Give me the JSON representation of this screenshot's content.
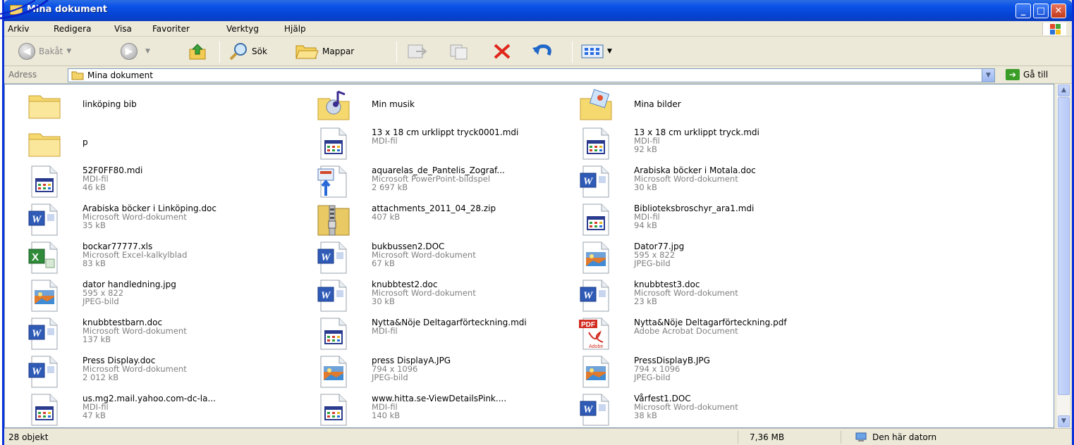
{
  "window": {
    "title": "Mina dokument"
  },
  "menu": [
    "Arkiv",
    "Redigera",
    "Visa",
    "Favoriter",
    "Verktyg",
    "Hjälp"
  ],
  "toolbar": {
    "back": "Bakåt",
    "search": "Sök",
    "folders": "Mappar"
  },
  "address": {
    "label": "Adress",
    "value": "Mina dokument",
    "go": "Gå till"
  },
  "items": [
    {
      "name": "linköping bib",
      "type": "",
      "size": "",
      "icon": "folder-icon"
    },
    {
      "name": "Min musik",
      "type": "",
      "size": "",
      "icon": "music-folder-icon"
    },
    {
      "name": "Mina bilder",
      "type": "",
      "size": "",
      "icon": "pictures-folder-icon"
    },
    {
      "name": "p",
      "type": "",
      "size": "",
      "icon": "folder-icon"
    },
    {
      "name": "13 x 18 cm urklippt tryck0001.mdi",
      "type": "MDI-fil",
      "size": "",
      "icon": "mdi-file-icon"
    },
    {
      "name": "13 x 18 cm urklippt tryck.mdi",
      "type": "MDI-fil",
      "size": "92 kB",
      "icon": "mdi-file-icon"
    },
    {
      "name": "52F0FF80.mdi",
      "type": "MDI-fil",
      "size": "46 kB",
      "icon": "mdi-file-icon"
    },
    {
      "name": "aquarelas_de_Pantelis_Zograf...",
      "type": "Microsoft PowerPoint-bildspel",
      "size": "2 697 kB",
      "icon": "powerpoint-file-icon"
    },
    {
      "name": "Arabiska böcker i Motala.doc",
      "type": "Microsoft Word-dokument",
      "size": "30 kB",
      "icon": "word-file-icon"
    },
    {
      "name": "Arabiska böcker i Linköping.doc",
      "type": "Microsoft Word-dokument",
      "size": "35 kB",
      "icon": "word-file-icon"
    },
    {
      "name": "attachments_2011_04_28.zip",
      "type": "407 kB",
      "size": "",
      "icon": "zip-folder-icon"
    },
    {
      "name": "Biblioteksbroschyr_ara1.mdi",
      "type": "MDI-fil",
      "size": "94 kB",
      "icon": "mdi-file-icon"
    },
    {
      "name": "bockar77777.xls",
      "type": "Microsoft Excel-kalkylblad",
      "size": "83 kB",
      "icon": "excel-file-icon"
    },
    {
      "name": "bukbussen2.DOC",
      "type": "Microsoft Word-dokument",
      "size": "67 kB",
      "icon": "word-file-icon"
    },
    {
      "name": "Dator77.jpg",
      "type": "595 x 822",
      "size": "JPEG-bild",
      "icon": "jpeg-file-icon"
    },
    {
      "name": "dator handledning.jpg",
      "type": "595 x 822",
      "size": "JPEG-bild",
      "icon": "jpeg-file-icon"
    },
    {
      "name": "knubbtest2.doc",
      "type": "Microsoft Word-dokument",
      "size": "30 kB",
      "icon": "word-file-icon"
    },
    {
      "name": "knubbtest3.doc",
      "type": "Microsoft Word-dokument",
      "size": "23 kB",
      "icon": "word-file-icon"
    },
    {
      "name": "knubbtestbarn.doc",
      "type": "Microsoft Word-dokument",
      "size": "137 kB",
      "icon": "word-file-icon"
    },
    {
      "name": "Nytta&Nöje Deltagarförteckning.mdi",
      "type": "MDI-fil",
      "size": "",
      "icon": "mdi-file-icon"
    },
    {
      "name": "Nytta&Nöje Deltagarförteckning.pdf",
      "type": "Adobe Acrobat Document",
      "size": "",
      "icon": "pdf-file-icon"
    },
    {
      "name": "Press Display.doc",
      "type": "Microsoft Word-dokument",
      "size": "2 012 kB",
      "icon": "word-file-icon"
    },
    {
      "name": "press DisplayA.JPG",
      "type": "794 x 1096",
      "size": "JPEG-bild",
      "icon": "jpeg-file-icon"
    },
    {
      "name": "PressDisplayB.JPG",
      "type": "794 x 1096",
      "size": "JPEG-bild",
      "icon": "jpeg-file-icon"
    },
    {
      "name": "us.mg2.mail.yahoo.com-dc-la...",
      "type": "MDI-fil",
      "size": "47 kB",
      "icon": "mdi-file-icon"
    },
    {
      "name": "www.hitta.se-ViewDetailsPink....",
      "type": "MDI-fil",
      "size": "140 kB",
      "icon": "mdi-file-icon"
    },
    {
      "name": "Vårfest1.DOC",
      "type": "Microsoft Word-dokument",
      "size": "38 kB",
      "icon": "word-file-icon"
    }
  ],
  "status": {
    "count": "28 objekt",
    "size": "7,36 MB",
    "location": "Den här datorn"
  }
}
